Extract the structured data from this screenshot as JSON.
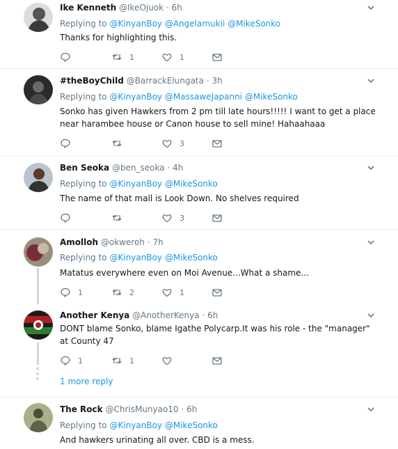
{
  "tweets": [
    {
      "name": "Ike Kenneth",
      "handle": "@IkeOjuok",
      "time": "6h",
      "replying": "Replying to",
      "mentions": [
        "@KinyanBoy",
        "@Angelamukii",
        "@MikeSonko"
      ],
      "text": "Thanks for highlighting this.",
      "replies": "",
      "retweets": "1",
      "likes": "1"
    },
    {
      "name": "#theBoyChild",
      "handle": "@BarrackElungata",
      "time": "3h",
      "replying": "Replying to",
      "mentions": [
        "@KinyanBoy",
        "@MassaweJapanni",
        "@MikeSonko"
      ],
      "text": "Sonko has given Hawkers from 2 pm till late hours!!!!! I want to get a place near harambee house or Canon house to sell mine! Hahaahaaa",
      "replies": "",
      "retweets": "",
      "likes": "3"
    },
    {
      "name": "Ben Seoka",
      "handle": "@ben_seoka",
      "time": "4h",
      "replying": "Replying to",
      "mentions": [
        "@KinyanBoy",
        "@MikeSonko"
      ],
      "text": "The name of that mall is Look Down. No shelves required",
      "replies": "",
      "retweets": "",
      "likes": "3"
    },
    {
      "name": "Amolloh",
      "handle": "@okweroh",
      "time": "7h",
      "replying": "Replying to",
      "mentions": [
        "@KinyanBoy",
        "@MikeSonko"
      ],
      "text": "Matatus everywhere even on Moi Avenue...What a shame...",
      "replies": "1",
      "retweets": "2",
      "likes": "1"
    },
    {
      "name": "Another Kenya",
      "handle": "@AnotherKenya",
      "time": "6h",
      "replying": "",
      "mentions": [],
      "text": "DONT blame Sonko, blame Igathe Polycarp.It was his role - the \"manager\" at County 47",
      "replies": "1",
      "retweets": "1",
      "likes": ""
    },
    {
      "name": "The Rock",
      "handle": "@ChrisMunyao10",
      "time": "6h",
      "replying": "Replying to",
      "mentions": [
        "@KinyanBoy",
        "@MikeSonko"
      ],
      "text": "And hawkers urinating all over. CBD is a mess.",
      "replies": "",
      "retweets": "",
      "likes": ""
    }
  ],
  "more_replies": "1 more reply",
  "colors": {
    "accent": "#1b95e0",
    "muted": "#657786",
    "separator": "#e6ecf0",
    "thread_line": "#ccd6dd"
  },
  "icons": {
    "reply": "reply-icon",
    "retweet": "retweet-icon",
    "like": "heart-icon",
    "dm": "envelope-icon",
    "menu": "chevron-down-icon"
  }
}
